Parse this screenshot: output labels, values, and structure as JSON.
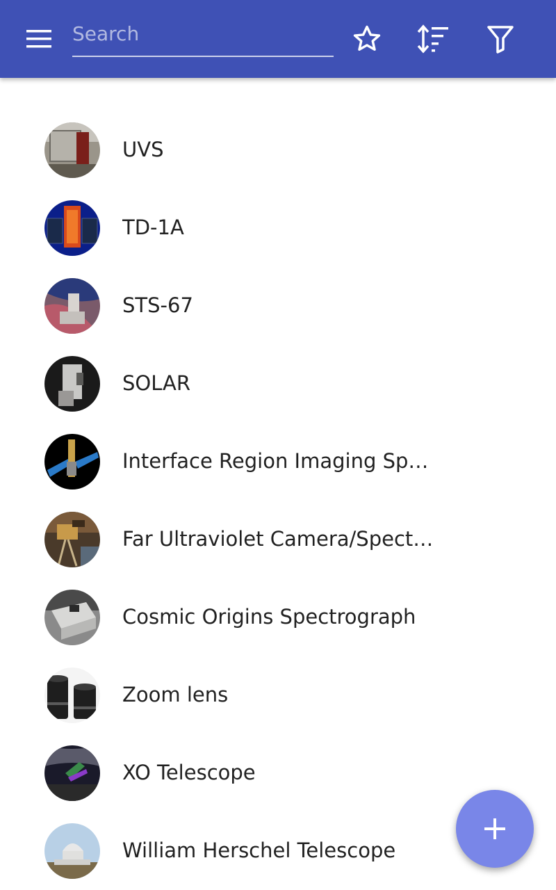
{
  "appbar": {
    "background": "#3f51b5",
    "menu_icon": "menu-icon",
    "search": {
      "placeholder": "Search",
      "value": ""
    },
    "actions": [
      {
        "name": "favorites",
        "icon": "star-outline-icon"
      },
      {
        "name": "sort",
        "icon": "sort-icon"
      },
      {
        "name": "filter",
        "icon": "filter-icon"
      }
    ]
  },
  "list": {
    "items": [
      {
        "label": "UVS",
        "thumbnail": "uvs-instrument-photo"
      },
      {
        "label": "TD-1A",
        "thumbnail": "td-1a-satellite-photo"
      },
      {
        "label": "STS-67",
        "thumbnail": "sts-67-shuttle-photo"
      },
      {
        "label": "SOLAR",
        "thumbnail": "solar-instrument-photo"
      },
      {
        "label": "Interface Region Imaging Spectrograph",
        "thumbnail": "iris-spacecraft-photo"
      },
      {
        "label": "Far Ultraviolet Camera/Spectrograph",
        "thumbnail": "far-uv-camera-photo"
      },
      {
        "label": "Cosmic Origins Spectrograph",
        "thumbnail": "cos-instrument-photo"
      },
      {
        "label": "Zoom lens",
        "thumbnail": "zoom-lens-photo"
      },
      {
        "label": "XO Telescope",
        "thumbnail": "xo-telescope-photo"
      },
      {
        "label": "William Herschel Telescope",
        "thumbnail": "herschel-telescope-photo"
      }
    ]
  },
  "fab": {
    "icon": "plus-icon",
    "color": "#7986e8"
  }
}
